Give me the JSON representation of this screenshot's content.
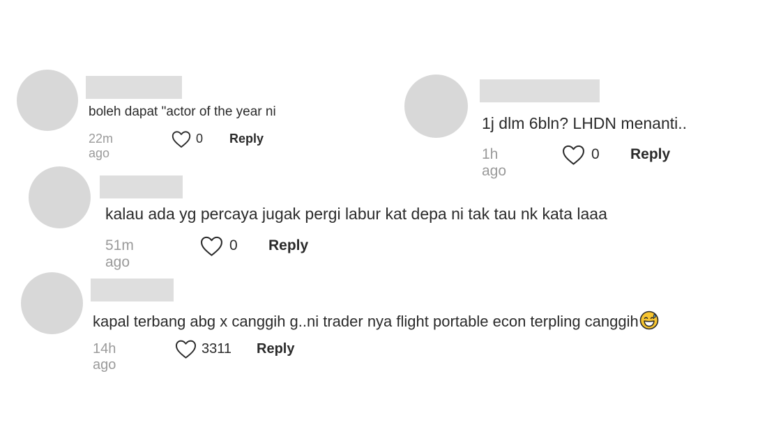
{
  "comments": [
    {
      "text": "boleh dapat \"actor of the year ni",
      "time": "22m ago",
      "likes": "0",
      "reply_label": "Reply"
    },
    {
      "text": "1j dlm 6bln? LHDN menanti..",
      "time": "1h ago",
      "likes": "0",
      "reply_label": "Reply"
    },
    {
      "text": "kalau ada yg percaya jugak pergi labur kat depa ni tak tau nk kata laaa",
      "time": "51m ago",
      "likes": "0",
      "reply_label": "Reply"
    },
    {
      "text": "kapal terbang abg x canggih g..ni trader nya flight portable econ terpling canggih",
      "time": "14h ago",
      "likes": "3311",
      "reply_label": "Reply",
      "emoji": "grinning-face-with-sweat-icon"
    }
  ],
  "colors": {
    "avatar": "#d8d8d8",
    "name_placeholder": "#dedede",
    "text": "#2a2a2a",
    "meta": "#9a9a9a",
    "emoji": "#f7c531"
  }
}
